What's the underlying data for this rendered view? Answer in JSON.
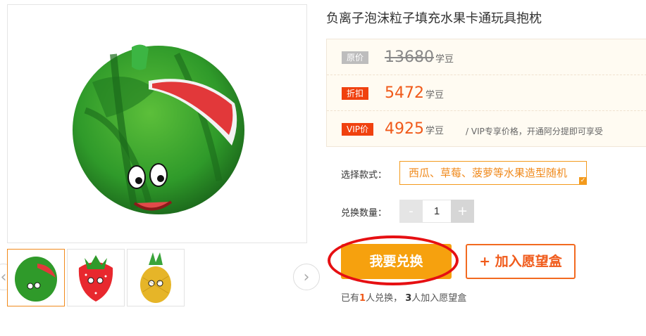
{
  "product": {
    "title": "负离子泡沫粒子填充水果卡通玩具抱枕"
  },
  "prices": {
    "original": {
      "tag": "原价",
      "value": "13680",
      "unit": "学豆"
    },
    "discount": {
      "tag": "折扣",
      "value": "5472",
      "unit": "学豆"
    },
    "vip": {
      "tag": "VIP价",
      "value": "4925",
      "unit": "学豆",
      "note": "/ VIP专享价格，开通阿分提即可享受"
    }
  },
  "options": {
    "style_label": "选择款式：",
    "style_value": "西瓜、草莓、菠萝等水果造型随机",
    "quantity_label": "兑换数量：",
    "quantity_value": "1",
    "minus": "-",
    "plus": "+"
  },
  "actions": {
    "exchange": "我要兑换",
    "wishlist": "+ 加入愿望盒"
  },
  "stats": {
    "prefix": "已有",
    "exchanged_count": "1",
    "exchanged_text": "人兑换，",
    "wish_count": "3",
    "wish_text": "人加入愿望盒"
  },
  "gallery": {
    "thumbnails": [
      "watermelon",
      "strawberry",
      "pineapple"
    ],
    "prev_icon": "chevron-left-icon",
    "next_icon": "chevron-right-icon"
  },
  "colors": {
    "accent_orange": "#f6a10e",
    "price_red": "#f05a1a",
    "highlight_ring": "#e60f12"
  }
}
